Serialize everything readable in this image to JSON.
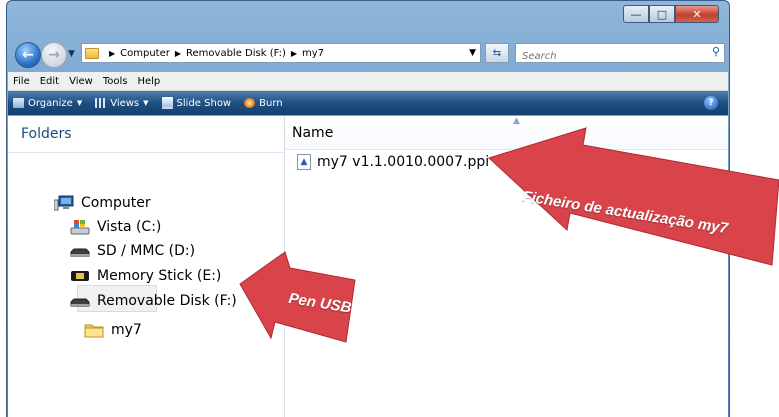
{
  "window": {
    "controls": [
      "minimize-icon",
      "maximize-icon",
      "close-icon"
    ]
  },
  "address": {
    "crumbs": [
      "Computer",
      "Removable Disk (F:)",
      "my7"
    ],
    "search_placeholder": "Search"
  },
  "menubar": {
    "items": [
      "File",
      "Edit",
      "View",
      "Tools",
      "Help"
    ]
  },
  "toolbar": {
    "organize": "Organize",
    "views": "Views",
    "slideshow": "Slide Show",
    "burn": "Burn"
  },
  "folders": {
    "header": "Folders",
    "items": [
      {
        "label": "Computer",
        "icon": "computer-icon"
      },
      {
        "label": "Vista (C:)",
        "icon": "windows-drive-icon"
      },
      {
        "label": "SD / MMC (D:)",
        "icon": "card-drive-icon"
      },
      {
        "label": "Memory Stick (E:)",
        "icon": "memory-stick-icon"
      },
      {
        "label": "Removable Disk (F:)",
        "icon": "removable-disk-icon"
      },
      {
        "label": "my7",
        "icon": "folder-icon"
      }
    ]
  },
  "files": {
    "column_name": "Name",
    "items": [
      {
        "name": "my7 v1.1.0010.0007.ppi",
        "icon": "file-icon"
      }
    ]
  },
  "annotations": {
    "file_callout": "Ficheiro de actualização my7",
    "usb_callout": "Pen USB"
  },
  "colors": {
    "callout_red": "#d9434a",
    "frame_blue": "#5d8fc4",
    "toolbar_blue": "#1e4f82"
  }
}
